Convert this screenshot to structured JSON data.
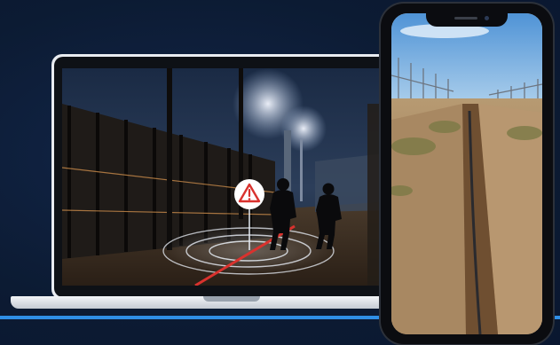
{
  "scene": {
    "laptop": {
      "screen_icon": "warning-triangle-icon"
    },
    "phone": {},
    "colors": {
      "background": "#0c1b33",
      "accent_line": "#2f8fe6",
      "alert_red": "#d9322e",
      "radar_ring": "#e8eef6"
    }
  }
}
